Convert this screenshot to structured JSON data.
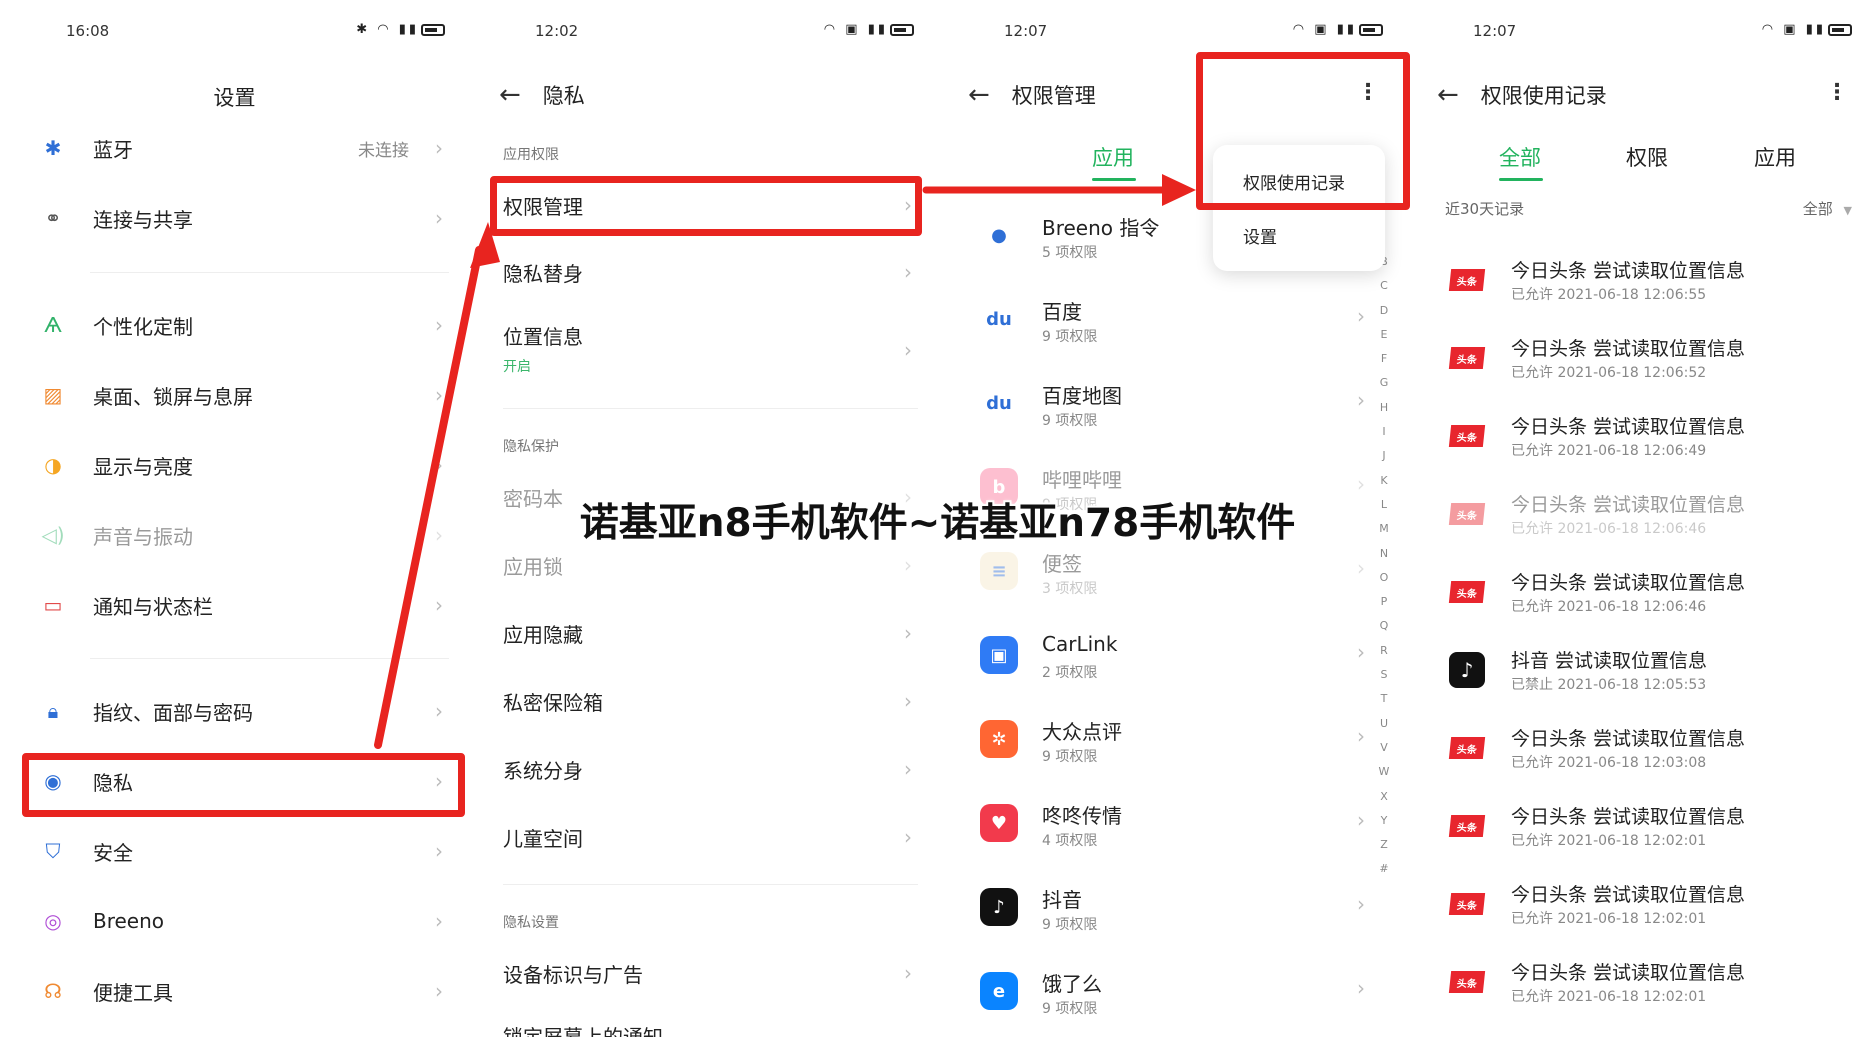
{
  "colors": {
    "accent_green": "#22b35e",
    "highlight_red": "#e8241f",
    "toutiao_red": "#e8262e"
  },
  "panel1": {
    "time": "16:08",
    "title": "设置",
    "items": [
      {
        "label": "蓝牙",
        "value": "未连接",
        "icon": "bluetooth-icon"
      },
      {
        "label": "连接与共享",
        "icon": "share-icon"
      },
      {
        "label": "个性化定制",
        "icon": "personalize-icon"
      },
      {
        "label": "桌面、锁屏与息屏",
        "icon": "desktop-icon"
      },
      {
        "label": "显示与亮度",
        "icon": "brightness-icon"
      },
      {
        "label": "声音与振动",
        "icon": "sound-icon"
      },
      {
        "label": "通知与状态栏",
        "icon": "notification-icon"
      },
      {
        "label": "指纹、面部与密码",
        "icon": "lock-icon"
      },
      {
        "label": "隐私",
        "icon": "privacy-eye-icon"
      },
      {
        "label": "安全",
        "icon": "shield-icon"
      },
      {
        "label": "Breeno",
        "icon": "breeno-icon"
      },
      {
        "label": "便捷工具",
        "icon": "tools-icon"
      }
    ]
  },
  "panel2": {
    "time": "12:02",
    "title": "隐私",
    "section_app": "应用权限",
    "permission_mgmt": "权限管理",
    "privacy_double": "隐私替身",
    "location": "位置信息",
    "location_state": "开启",
    "section_protect": "隐私保护",
    "password_book": "密码本",
    "app_lock": "应用锁",
    "app_hide": "应用隐藏",
    "private_safe": "私密保险箱",
    "clone_system": "系统分身",
    "kids_space": "儿童空间",
    "section_settings": "隐私设置",
    "device_ads": "设备标识与广告",
    "lock_notify": "锁定屏幕上的通知"
  },
  "panel3": {
    "time": "12:07",
    "title": "权限管理",
    "tab": "应用",
    "menu": {
      "item1": "权限使用记录",
      "item2": "设置"
    },
    "apps": [
      {
        "name": "Breeno 指令",
        "sub": "5 项权限",
        "color": "#ffffff",
        "glyph": "●"
      },
      {
        "name": "百度",
        "sub": "9 项权限",
        "color": "#ffffff",
        "glyph": "du"
      },
      {
        "name": "百度地图",
        "sub": "9 项权限",
        "color": "#ffffff",
        "glyph": "du"
      },
      {
        "name": "哔哩哔哩",
        "sub": "9 项权限",
        "color": "#fb7299",
        "glyph": "b"
      },
      {
        "name": "便签",
        "sub": "3 项权限",
        "color": "#f6e7c8",
        "glyph": "≡"
      },
      {
        "name": "CarLink",
        "sub": "2 项权限",
        "color": "#2f7bf5",
        "glyph": "▣"
      },
      {
        "name": "大众点评",
        "sub": "9 项权限",
        "color": "#ff6633",
        "glyph": "✲"
      },
      {
        "name": "咚咚传情",
        "sub": "4 项权限",
        "color": "#f23a4c",
        "glyph": "♥"
      },
      {
        "name": "抖音",
        "sub": "9 项权限",
        "color": "#111111",
        "glyph": "♪"
      },
      {
        "name": "饿了么",
        "sub": "9 项权限",
        "color": "#0a84ff",
        "glyph": "e"
      }
    ],
    "alphabet": [
      "B",
      "C",
      "D",
      "E",
      "F",
      "G",
      "H",
      "I",
      "J",
      "K",
      "L",
      "M",
      "N",
      "O",
      "P",
      "Q",
      "R",
      "S",
      "T",
      "U",
      "V",
      "W",
      "X",
      "Y",
      "Z",
      "#"
    ]
  },
  "panel4": {
    "time": "12:07",
    "title": "权限使用记录",
    "tabs": [
      "全部",
      "权限",
      "应用"
    ],
    "period": "近30天记录",
    "filter": "全部",
    "logs": [
      {
        "name": "今日头条 尝试读取位置信息",
        "sub": "已允许 2021-06-18 12:06:55",
        "app": "toutiao"
      },
      {
        "name": "今日头条 尝试读取位置信息",
        "sub": "已允许 2021-06-18 12:06:52",
        "app": "toutiao"
      },
      {
        "name": "今日头条 尝试读取位置信息",
        "sub": "已允许 2021-06-18 12:06:49",
        "app": "toutiao"
      },
      {
        "name": "今日头条 尝试读取位置信息",
        "sub": "已允许 2021-06-18 12:06:46",
        "app": "toutiao"
      },
      {
        "name": "今日头条 尝试读取位置信息",
        "sub": "已允许 2021-06-18 12:06:46",
        "app": "toutiao"
      },
      {
        "name": "抖音 尝试读取位置信息",
        "sub": "已禁止 2021-06-18 12:05:53",
        "app": "douyin"
      },
      {
        "name": "今日头条 尝试读取位置信息",
        "sub": "已允许 2021-06-18 12:03:08",
        "app": "toutiao"
      },
      {
        "name": "今日头条 尝试读取位置信息",
        "sub": "已允许 2021-06-18 12:02:01",
        "app": "toutiao"
      },
      {
        "name": "今日头条 尝试读取位置信息",
        "sub": "已允许 2021-06-18 12:02:01",
        "app": "toutiao"
      },
      {
        "name": "今日头条 尝试读取位置信息",
        "sub": "已允许 2021-06-18 12:02:01",
        "app": "toutiao"
      }
    ],
    "toutiao_badge": "头条"
  },
  "watermark": "诺基亚n8手机软件~诺基亚n78手机软件"
}
